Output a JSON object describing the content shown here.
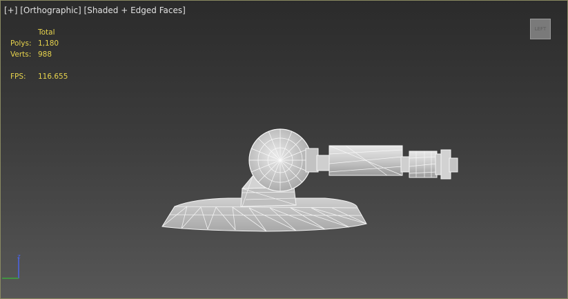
{
  "viewport": {
    "labels": {
      "plus": "[+]",
      "view": "[Orthographic]",
      "shading": "[Shaded + Edged Faces]"
    },
    "stats": {
      "header": "Total",
      "polys_label": "Polys:",
      "polys_value": "1,180",
      "verts_label": "Verts:",
      "verts_value": "988",
      "fps_label": "FPS:",
      "fps_value": "116.655"
    },
    "viewcube_label": "LEFT",
    "gizmo_axis_label": "z"
  },
  "colors": {
    "stats_text": "#e8d44d",
    "border": "#8a8a62",
    "axis_z": "#4a64e8",
    "axis_y": "#3caa3c"
  }
}
